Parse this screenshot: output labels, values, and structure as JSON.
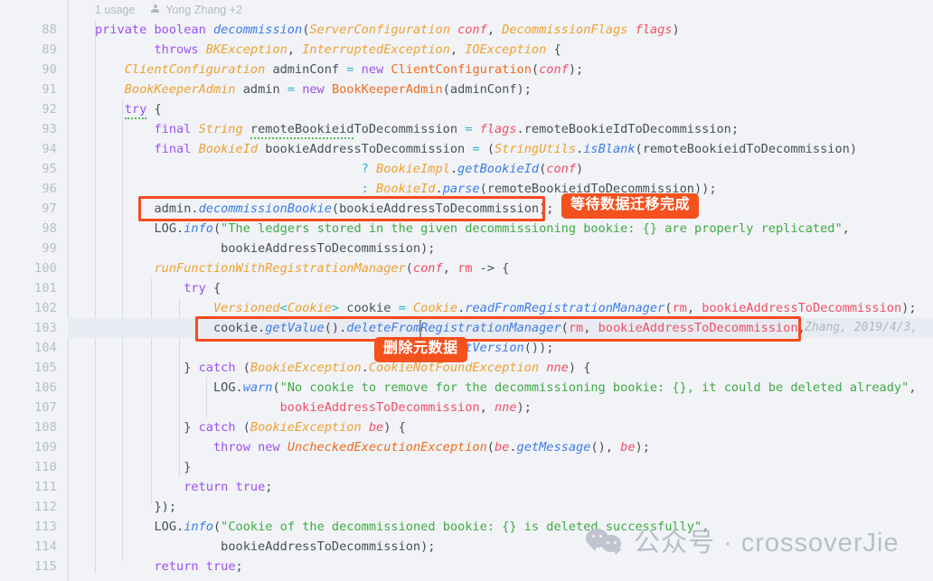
{
  "editor": {
    "theme_background": "#f1f3f7",
    "highlight_line_background": "#e8ebf1",
    "annotation_color": "#f4511e",
    "code_vision": {
      "usages": "1 usage",
      "authors": "Yong Zhang +2",
      "person_icon": "person-icon"
    },
    "first_line_number": 88,
    "line_numbers": [
      88,
      89,
      90,
      91,
      92,
      93,
      94,
      95,
      96,
      97,
      98,
      99,
      100,
      101,
      102,
      103,
      104,
      105,
      106,
      107,
      108,
      109,
      110,
      111,
      112,
      113,
      114,
      115
    ],
    "lines": [
      {
        "n": 88,
        "text": "private boolean decommission(ServerConfiguration conf, DecommissionFlags flags)"
      },
      {
        "n": 89,
        "text": "        throws BKException, InterruptedException, IOException {"
      },
      {
        "n": 90,
        "text": "    ClientConfiguration adminConf = new ClientConfiguration(conf);"
      },
      {
        "n": 91,
        "text": "    BookKeeperAdmin admin = new BookKeeperAdmin(adminConf);"
      },
      {
        "n": 92,
        "text": "    try {"
      },
      {
        "n": 93,
        "text": "        final String remoteBookieidToDecommission = flags.remoteBookieIdToDecommission;"
      },
      {
        "n": 94,
        "text": "        final BookieId bookieAddressToDecommission = (StringUtils.isBlank(remoteBookieidToDecommission)"
      },
      {
        "n": 95,
        "text": "                              ? BookieImpl.getBookieId(conf)"
      },
      {
        "n": 96,
        "text": "                              : BookieId.parse(remoteBookieidToDecommission));"
      },
      {
        "n": 97,
        "text": "        admin.decommissionBookie(bookieAddressToDecommission);"
      },
      {
        "n": 98,
        "text": "        LOG.info(\"The ledgers stored in the given decommissioning bookie: {} are properly replicated\","
      },
      {
        "n": 99,
        "text": "                 bookieAddressToDecommission);"
      },
      {
        "n": 100,
        "text": "        runFunctionWithRegistrationManager(conf, rm -> {"
      },
      {
        "n": 101,
        "text": "            try {"
      },
      {
        "n": 102,
        "text": "                Versioned<Cookie> cookie = Cookie.readFromRegistrationManager(rm, bookieAddressToDecommission);"
      },
      {
        "n": 103,
        "text": "                cookie.getValue().deleteFromRegistrationManager(rm, bookieAddressToDecommission,"
      },
      {
        "n": 104,
        "text": "                                         cookie.getVersion());"
      },
      {
        "n": 105,
        "text": "            } catch (BookieException.CookieNotFoundException nne) {"
      },
      {
        "n": 106,
        "text": "                LOG.warn(\"No cookie to remove for the decommissioning bookie: {}, it could be deleted already\","
      },
      {
        "n": 107,
        "text": "                         bookieAddressToDecommission, nne);"
      },
      {
        "n": 108,
        "text": "            } catch (BookieException be) {"
      },
      {
        "n": 109,
        "text": "                throw new UncheckedExecutionException(be.getMessage(), be);"
      },
      {
        "n": 110,
        "text": "            }"
      },
      {
        "n": 111,
        "text": "            return true;"
      },
      {
        "n": 112,
        "text": "        });"
      },
      {
        "n": 113,
        "text": "        LOG.info(\"Cookie of the decommissioned bookie: {} is deleted successfully\","
      },
      {
        "n": 114,
        "text": "                 bookieAddressToDecommission);"
      },
      {
        "n": 115,
        "text": "        return true;"
      }
    ],
    "current_line": 103,
    "caret_position": "line 103, after deleteFrom"
  },
  "annotations": [
    {
      "id": "wait-migration",
      "label": "等待数据迁移完成",
      "target_line": 97
    },
    {
      "id": "delete-metadata",
      "label": "删除元数据",
      "target_line": 103
    }
  ],
  "blame": {
    "line_103": "Zhang, 2019/4/3,"
  },
  "watermark": {
    "icon": "wechat-icon",
    "text": "公众号 · crossoverJie"
  }
}
